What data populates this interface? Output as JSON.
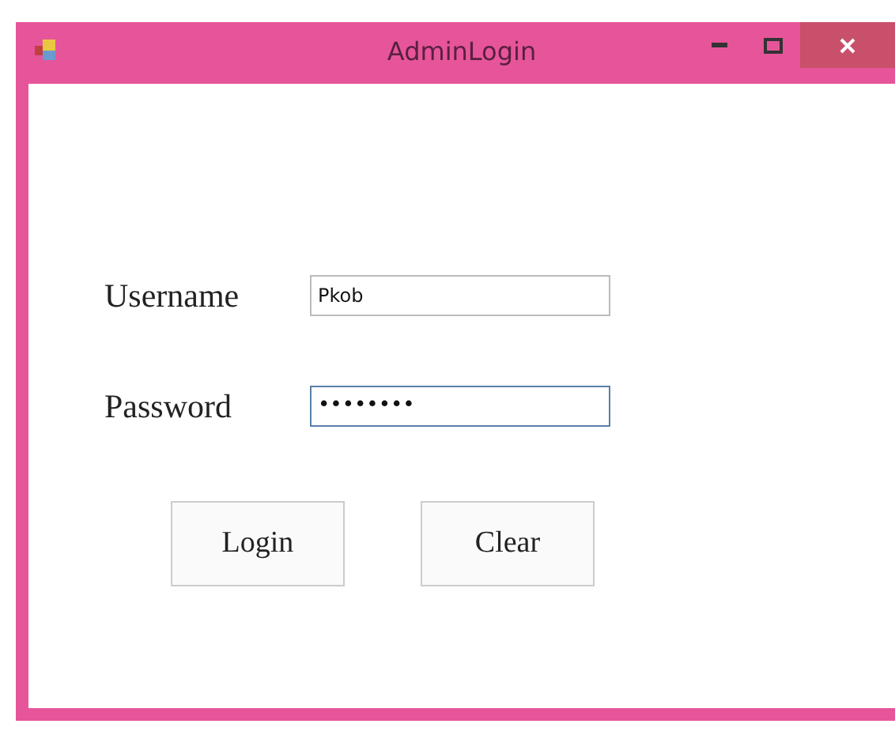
{
  "window": {
    "title": "AdminLogin"
  },
  "fields": [
    {
      "label": "Username",
      "value": "Pkob",
      "focused": false
    },
    {
      "label": "Password",
      "value": "••••••••",
      "focused": true
    }
  ],
  "buttons": [
    "Login",
    "Clear"
  ]
}
